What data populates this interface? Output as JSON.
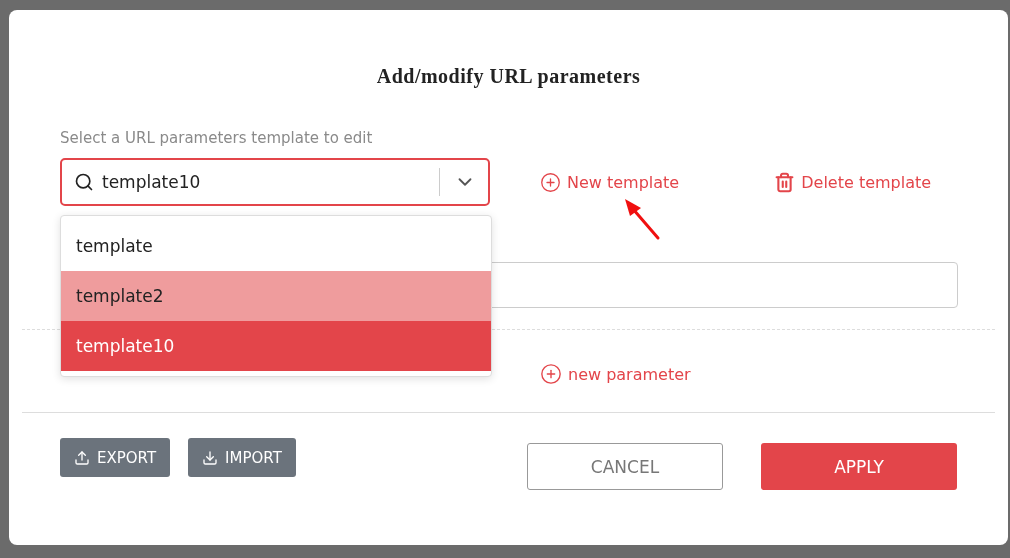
{
  "dialog": {
    "title": "Add/modify URL parameters"
  },
  "template_select": {
    "label": "Select a URL parameters template to edit",
    "value": "template10",
    "expanded": true,
    "options": [
      {
        "label": "template",
        "selected": false,
        "hovered": false
      },
      {
        "label": "template2",
        "selected": false,
        "hovered": true
      },
      {
        "label": "template10",
        "selected": true,
        "hovered": false
      }
    ]
  },
  "template_actions": [
    {
      "kind": "add",
      "label": "New template"
    },
    {
      "kind": "delete",
      "label": "Delete template"
    }
  ],
  "parameter_actions": [
    {
      "label": "new parameter"
    }
  ],
  "file_buttons": [
    {
      "kind": "export",
      "label": "EXPORT"
    },
    {
      "kind": "import",
      "label": "IMPORT"
    }
  ],
  "buttons": [
    {
      "kind": "secondary",
      "label": "CANCEL"
    },
    {
      "kind": "primary",
      "label": "APPLY"
    }
  ]
}
